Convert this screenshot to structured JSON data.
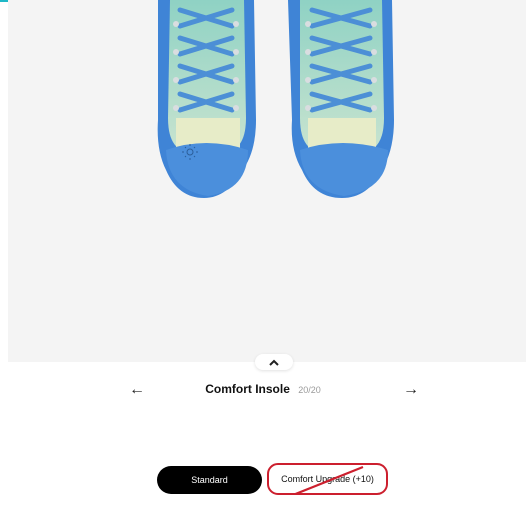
{
  "colors": {
    "accent_bar": "#1fb8c7",
    "shoe_sole": "#3f84d6",
    "shoe_upper": "#9fd6c9",
    "unavailable_border": "#cc1f2e"
  },
  "preview": {
    "collapse_icon": "chevron-up-icon"
  },
  "navigation": {
    "prev_icon": "arrow-left-icon",
    "next_icon": "arrow-right-icon",
    "prev_glyph": "←",
    "next_glyph": "→",
    "step_name": "Comfort Insole",
    "step_count": "20/20"
  },
  "options": [
    {
      "label": "Standard",
      "selected": true,
      "available": true
    },
    {
      "label": "Comfort Upgrade (+10)",
      "selected": false,
      "available": false
    }
  ]
}
